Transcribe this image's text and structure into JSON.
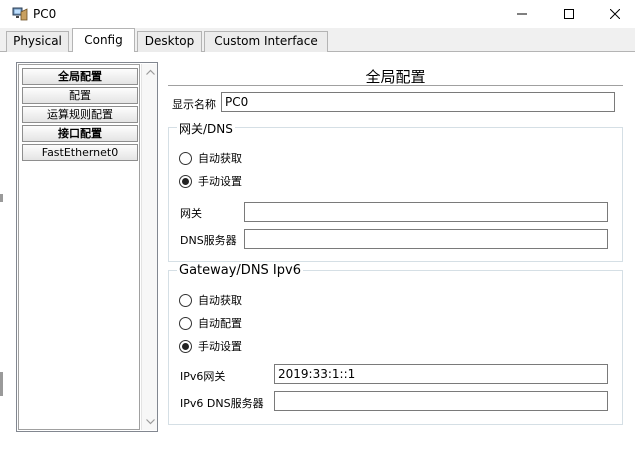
{
  "window": {
    "title": "PC0",
    "minimize_label": "Minimize",
    "maximize_label": "Maximize",
    "close_label": "Close"
  },
  "tabs": [
    {
      "label": "Physical",
      "active": false
    },
    {
      "label": "Config",
      "active": true
    },
    {
      "label": "Desktop",
      "active": false
    },
    {
      "label": "Custom Interface",
      "active": false
    }
  ],
  "sidebar": {
    "items": [
      {
        "label": "全局配置",
        "bold": true
      },
      {
        "label": "配置",
        "bold": false
      },
      {
        "label": "运算规则配置",
        "bold": false
      },
      {
        "label": "接口配置",
        "bold": true
      },
      {
        "label": "FastEthernet0",
        "bold": false
      }
    ]
  },
  "main": {
    "section_title": "全局配置",
    "display_name": {
      "label": "显示名称",
      "value": "PC0"
    },
    "gateway_dns": {
      "legend": "网关/DNS",
      "options": [
        {
          "label": "自动获取",
          "checked": false
        },
        {
          "label": "手动设置",
          "checked": true
        }
      ],
      "gateway": {
        "label": "网关",
        "value": ""
      },
      "dns_server": {
        "label": "DNS服务器",
        "value": ""
      }
    },
    "gateway_dns_ipv6": {
      "legend": "Gateway/DNS Ipv6",
      "options": [
        {
          "label": "自动获取",
          "checked": false
        },
        {
          "label": "自动配置",
          "checked": false
        },
        {
          "label": "手动设置",
          "checked": true
        }
      ],
      "ipv6_gateway": {
        "label": "IPv6网关",
        "value": "2019:33:1::1"
      },
      "ipv6_dns_server": {
        "label": "IPv6 DNS服务器",
        "value": ""
      }
    }
  },
  "colors": {
    "window_bg": "#f0f0f0",
    "content_bg": "#ffffff",
    "border": "#7a7a7a",
    "groupbox_border": "#d5dfe5"
  }
}
